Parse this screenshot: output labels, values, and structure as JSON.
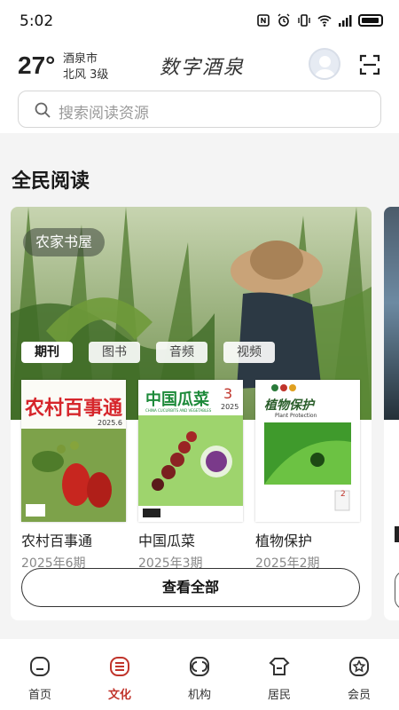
{
  "status_bar": {
    "time": "5:02"
  },
  "header": {
    "temperature": "27°",
    "city": "酒泉市",
    "wind": "北风  3级",
    "app_title": "数字酒泉"
  },
  "search": {
    "placeholder": "搜索阅读资源"
  },
  "section": {
    "title": "全民阅读"
  },
  "card": {
    "badge": "农家书屋",
    "tabs": [
      {
        "label": "期刊",
        "active": true
      },
      {
        "label": "图书",
        "active": false
      },
      {
        "label": "音频",
        "active": false
      },
      {
        "label": "视频",
        "active": false
      }
    ],
    "magazines": [
      {
        "name": "农村百事通",
        "issue": "2025年6期",
        "cover_title": "农村百事通",
        "cover_sub": "2025.6"
      },
      {
        "name": "中国瓜菜",
        "issue": "2025年3期",
        "cover_title": "中国瓜菜",
        "cover_sub": "CHINA CUCURBITS AND VEGETABLES",
        "cover_num": "3",
        "cover_year": "2025"
      },
      {
        "name": "植物保护",
        "issue": "2025年2期",
        "cover_title": "植物保护",
        "cover_sub": "Plant Protection",
        "cover_num": "2"
      }
    ],
    "view_all": "查看全部"
  },
  "tabbar": {
    "items": [
      {
        "label": "首页",
        "icon": "home-icon",
        "active": false
      },
      {
        "label": "文化",
        "icon": "culture-icon",
        "active": true
      },
      {
        "label": "机构",
        "icon": "institution-icon",
        "active": false
      },
      {
        "label": "居民",
        "icon": "resident-icon",
        "active": false
      },
      {
        "label": "会员",
        "icon": "member-icon",
        "active": false
      }
    ]
  },
  "colors": {
    "accent": "#c0342b",
    "cover_green": "#2e8b3e",
    "cover_red": "#d6262b"
  }
}
